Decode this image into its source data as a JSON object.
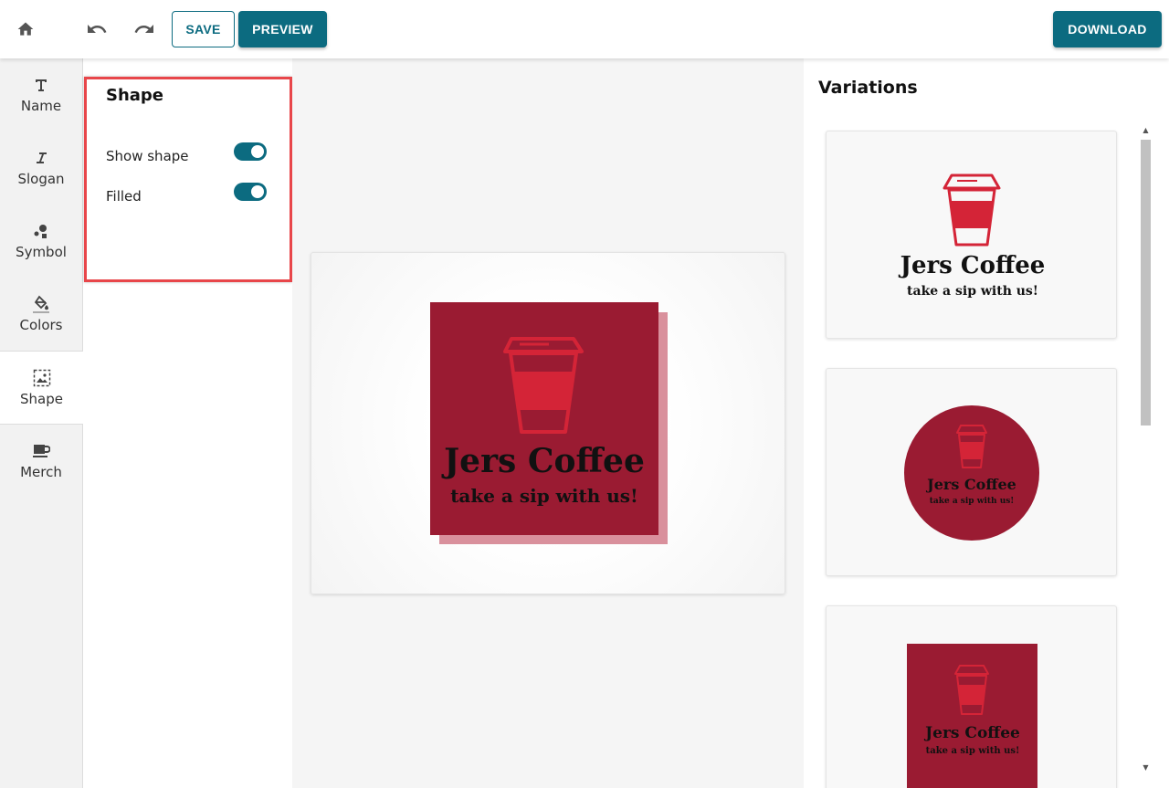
{
  "toolbar": {
    "home_icon": "home-icon",
    "undo_icon": "undo-icon",
    "redo_icon": "redo-icon",
    "save_label": "SAVE",
    "preview_label": "PREVIEW",
    "download_label": "DOWNLOAD"
  },
  "sidebar": {
    "items": [
      {
        "label": "Name",
        "icon": "text-icon"
      },
      {
        "label": "Slogan",
        "icon": "italic-icon"
      },
      {
        "label": "Symbol",
        "icon": "shapes-icon"
      },
      {
        "label": "Colors",
        "icon": "paint-bucket-icon"
      },
      {
        "label": "Shape",
        "icon": "image-frame-icon",
        "active": true
      },
      {
        "label": "Merch",
        "icon": "mug-icon"
      }
    ]
  },
  "panel": {
    "title": "Shape",
    "options": [
      {
        "label": "Show shape",
        "enabled": true
      },
      {
        "label": "Filled",
        "enabled": true
      }
    ]
  },
  "logo": {
    "name": "Jers Coffee",
    "slogan": "take a sip with us!",
    "colors": {
      "shape": "#9a1b32",
      "shadow": "#d9909c",
      "symbol": "#d42437",
      "text": "#111111"
    }
  },
  "variations": {
    "title": "Variations",
    "cards": [
      {
        "name": "Jers Coffee",
        "slogan": "take a sip with us!",
        "style": "no-shape"
      },
      {
        "name": "Jers Coffee",
        "slogan": "take a sip with us!",
        "style": "circle"
      },
      {
        "name": "Jers Coffee",
        "slogan": "take a sip with us!",
        "style": "square"
      }
    ]
  },
  "theme": {
    "accent": "#0c6b80",
    "highlight": "#e8464a"
  }
}
